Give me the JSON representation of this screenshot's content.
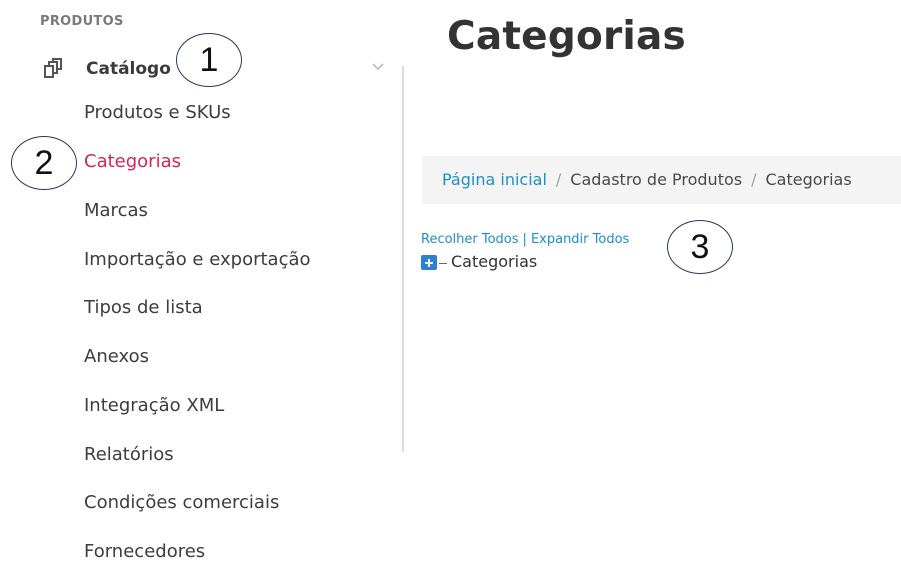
{
  "sidebar": {
    "section_heading": "PRODUTOS",
    "catalog_label": "Catálogo",
    "items": [
      {
        "label": "Produtos e SKUs"
      },
      {
        "label": "Categorias"
      },
      {
        "label": "Marcas"
      },
      {
        "label": "Importação e exportação"
      },
      {
        "label": "Tipos de lista"
      },
      {
        "label": "Anexos"
      },
      {
        "label": "Integração XML"
      },
      {
        "label": "Relatórios"
      },
      {
        "label": "Condições comerciais"
      },
      {
        "label": "Fornecedores"
      }
    ],
    "active_item": "Categorias"
  },
  "main": {
    "title": "Categorias",
    "breadcrumb": {
      "home": "Página inicial",
      "middle": "Cadastro de Produtos",
      "current": "Categorias",
      "separator": "/"
    },
    "tree_controls": {
      "collapse_all": "Recolher Todos",
      "separator": "|",
      "expand_all": "Expandir Todos"
    },
    "tree_root": "Categorias"
  },
  "annotations": {
    "one": "1",
    "two": "2",
    "three": "3"
  },
  "colors": {
    "active": "#d6245c",
    "link": "#1e8fc9",
    "expand_icon": "#2f7fd4"
  },
  "icons": {
    "catalog": "catalog-stack-icon",
    "chevron": "chevron-down-icon",
    "expand": "plus-box-icon"
  }
}
